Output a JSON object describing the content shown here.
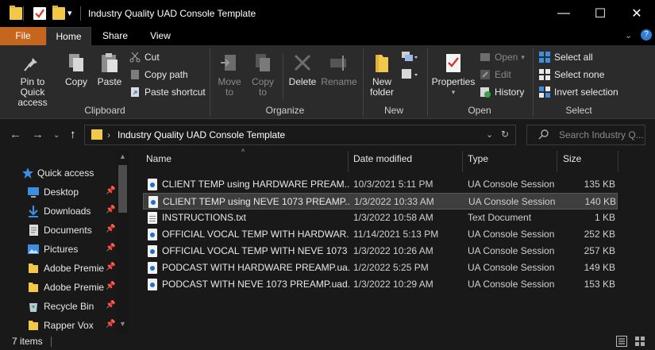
{
  "window": {
    "title": "Industry Quality UAD Console Template",
    "minimize_glyph": "—",
    "maximize_glyph": "☐",
    "close_glyph": "✕"
  },
  "ribbon_tabs": {
    "file": "File",
    "home": "Home",
    "share": "Share",
    "view": "View"
  },
  "ribbon": {
    "clipboard": {
      "label": "Clipboard",
      "pin": "Pin to Quick access",
      "copy": "Copy",
      "paste": "Paste",
      "cut": "Cut",
      "copy_path": "Copy path",
      "paste_shortcut": "Paste shortcut"
    },
    "organize": {
      "label": "Organize",
      "move_to": "Move to",
      "copy_to": "Copy to",
      "delete": "Delete",
      "rename": "Rename"
    },
    "new": {
      "label": "New",
      "new_folder": "New folder"
    },
    "open": {
      "label": "Open",
      "properties": "Properties",
      "open": "Open",
      "edit": "Edit",
      "history": "History"
    },
    "select": {
      "label": "Select",
      "select_all": "Select all",
      "select_none": "Select none",
      "invert": "Invert selection"
    }
  },
  "address": {
    "path": "Industry Quality UAD Console Template",
    "search_placeholder": "Search Industry Q..."
  },
  "nav": {
    "items": [
      {
        "label": "Quick access",
        "icon": "star-icon",
        "pinned": false
      },
      {
        "label": "Desktop",
        "icon": "desktop-icon",
        "pinned": true
      },
      {
        "label": "Downloads",
        "icon": "download-icon",
        "pinned": true
      },
      {
        "label": "Documents",
        "icon": "documents-icon",
        "pinned": true
      },
      {
        "label": "Pictures",
        "icon": "pictures-icon",
        "pinned": true
      },
      {
        "label": "Adobe Premie",
        "icon": "folder-icon",
        "pinned": true
      },
      {
        "label": "Adobe Premie",
        "icon": "folder-icon",
        "pinned": true
      },
      {
        "label": "Recycle Bin",
        "icon": "recycle-bin-icon",
        "pinned": true
      },
      {
        "label": "Rapper Vox",
        "icon": "folder-icon",
        "pinned": true
      }
    ],
    "pin_glyph": "📌"
  },
  "columns": {
    "name": "Name",
    "date": "Date modified",
    "type": "Type",
    "size": "Size"
  },
  "files": [
    {
      "name": "CLIENT TEMP using HARDWARE PREAM...",
      "date": "10/3/2021 5:11 PM",
      "type": "UA Console Session",
      "size": "135 KB",
      "kind": "session",
      "selected": false
    },
    {
      "name": "CLIENT TEMP using NEVE 1073 PREAMP....",
      "date": "1/3/2022 10:33 AM",
      "type": "UA Console Session",
      "size": "140 KB",
      "kind": "session",
      "selected": true
    },
    {
      "name": "INSTRUCTIONS.txt",
      "date": "1/3/2022 10:58 AM",
      "type": "Text Document",
      "size": "1 KB",
      "kind": "txt",
      "selected": false
    },
    {
      "name": "OFFICIAL VOCAL TEMP WITH HARDWAR...",
      "date": "11/14/2021 5:13 PM",
      "type": "UA Console Session",
      "size": "252 KB",
      "kind": "session",
      "selected": false
    },
    {
      "name": "OFFICIAL VOCAL TEMP WITH NEVE 1073 ...",
      "date": "1/3/2022 10:26 AM",
      "type": "UA Console Session",
      "size": "257 KB",
      "kind": "session",
      "selected": false
    },
    {
      "name": "PODCAST WITH HARDWARE PREAMP.ua...",
      "date": "1/2/2022 5:25 PM",
      "type": "UA Console Session",
      "size": "149 KB",
      "kind": "session",
      "selected": false
    },
    {
      "name": "PODCAST WITH NEVE 1073 PREAMP.uad...",
      "date": "1/3/2022 10:29 AM",
      "type": "UA Console Session",
      "size": "153 KB",
      "kind": "session",
      "selected": false
    }
  ],
  "status": {
    "item_count": "7 items"
  },
  "colors": {
    "file_tab": "#c4661d",
    "background": "#191919",
    "ribbon": "#2b2b2b",
    "accent_blue": "#1f6fd0",
    "folder": "#f2c84b"
  }
}
